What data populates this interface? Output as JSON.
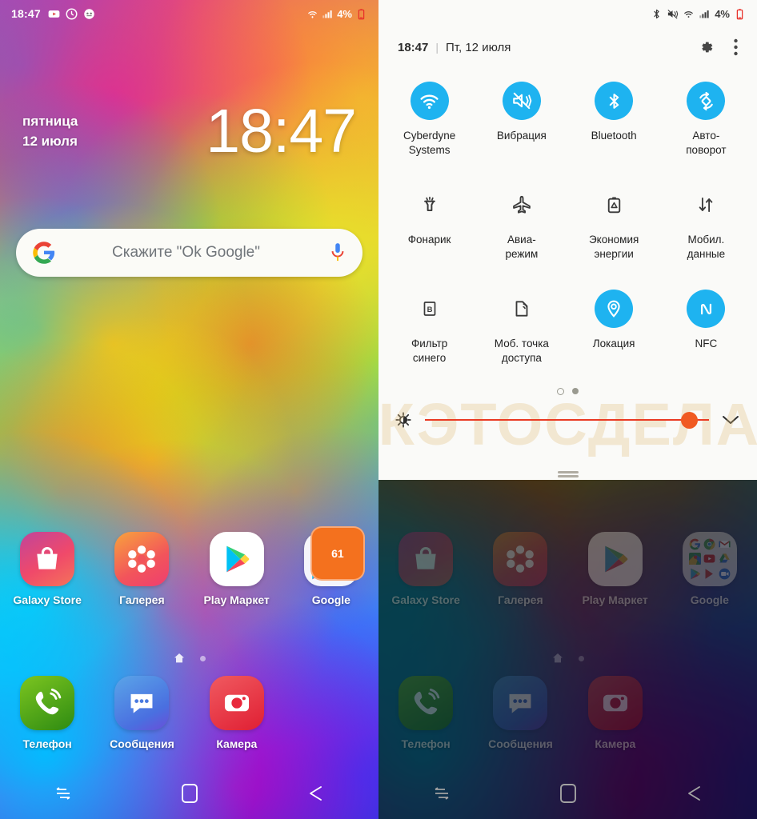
{
  "left_screen": {
    "status_bar": {
      "time": "18:47",
      "left_icons": [
        "youtube-icon",
        "clock-icon",
        "app-icon"
      ],
      "right_icons": [
        "wifi-icon",
        "signal-icon"
      ],
      "battery_percent": "4%"
    },
    "clock_widget": {
      "weekday": "пятница",
      "date": "12 июля",
      "time": "18:47"
    },
    "search_bar": {
      "hint": "Скажите \"Ok Google\"",
      "logo": "google-g-logo",
      "mic": "microphone-icon"
    },
    "apps_row1": [
      {
        "label": "Galaxy Store",
        "icon": "galaxy-store-icon",
        "badge": ""
      },
      {
        "label": "Галерея",
        "icon": "gallery-icon",
        "badge": ""
      },
      {
        "label": "Play Маркет",
        "icon": "play-store-icon",
        "badge": ""
      },
      {
        "label": "Google",
        "icon": "google-folder-icon",
        "badge": "61"
      }
    ],
    "dock": [
      {
        "label": "Телефон",
        "icon": "phone-icon"
      },
      {
        "label": "Сообщения",
        "icon": "messages-icon"
      },
      {
        "label": "Камера",
        "icon": "camera-icon"
      }
    ],
    "page_indicator": {
      "pages": 2,
      "current": 1
    },
    "navbar": [
      "recents-icon",
      "home-icon",
      "back-icon"
    ]
  },
  "right_screen": {
    "status_bar": {
      "icons": [
        "bluetooth-icon",
        "mute-vibrate-icon",
        "wifi-icon",
        "signal-icon"
      ],
      "battery_percent": "4%"
    },
    "panel_header": {
      "time": "18:47",
      "separator": "|",
      "date": "Пт, 12 июля",
      "settings": "gear-icon",
      "more": "more-vertical-icon"
    },
    "tiles": [
      {
        "label": "Cyberdyne\nSystems",
        "label_lines": [
          "Cyberdyne",
          "Systems"
        ],
        "icon": "wifi-icon",
        "active": true
      },
      {
        "label": "Вибрация",
        "label_lines": [
          "Вибрация"
        ],
        "icon": "vibrate-icon",
        "active": true
      },
      {
        "label": "Bluetooth",
        "label_lines": [
          "Bluetooth"
        ],
        "icon": "bluetooth-icon",
        "active": true
      },
      {
        "label": "Авто-поворот",
        "label_lines": [
          "Авто-",
          "поворот"
        ],
        "icon": "auto-rotate-icon",
        "active": true
      },
      {
        "label": "Фонарик",
        "label_lines": [
          "Фонарик"
        ],
        "icon": "flashlight-icon",
        "active": false
      },
      {
        "label": "Авиа-режим",
        "label_lines": [
          "Авиа-",
          "режим"
        ],
        "icon": "airplane-icon",
        "active": false
      },
      {
        "label": "Экономия энергии",
        "label_lines": [
          "Экономия",
          "энергии"
        ],
        "icon": "battery-saver-icon",
        "active": false
      },
      {
        "label": "Мобил. данные",
        "label_lines": [
          "Мобил.",
          "данные"
        ],
        "icon": "mobile-data-icon",
        "active": false,
        "highlighted": true
      },
      {
        "label": "Фильтр синего",
        "label_lines": [
          "Фильтр",
          "синего"
        ],
        "icon": "blue-light-filter-icon",
        "active": false
      },
      {
        "label": "Моб. точка доступа",
        "label_lines": [
          "Моб. точка",
          "доступа"
        ],
        "icon": "hotspot-icon",
        "active": false
      },
      {
        "label": "Локация",
        "label_lines": [
          "Локация"
        ],
        "icon": "location-icon",
        "active": true
      },
      {
        "label": "NFC",
        "label_lines": [
          "NFC"
        ],
        "icon": "nfc-icon",
        "active": true
      }
    ],
    "page_indicator": {
      "pages": 2,
      "current": 1
    },
    "brightness": {
      "icon": "brightness-icon",
      "value_percent": 96,
      "expand": "chevron-down-icon"
    },
    "watermark": "КАКЭТОСДЕЛАТЬ",
    "annotation": {
      "shape": "circle",
      "color": "#d4663c",
      "target": "Мобил. данные"
    }
  },
  "colors": {
    "tile_active": "#1eb3f0",
    "tile_inactive": "#4a4a4a",
    "annotation": "#d4663c",
    "slider": "#ea3a23",
    "slider_thumb": "#f05a22",
    "badge": "#f4711e",
    "panel_bg": "#fafaf8"
  }
}
